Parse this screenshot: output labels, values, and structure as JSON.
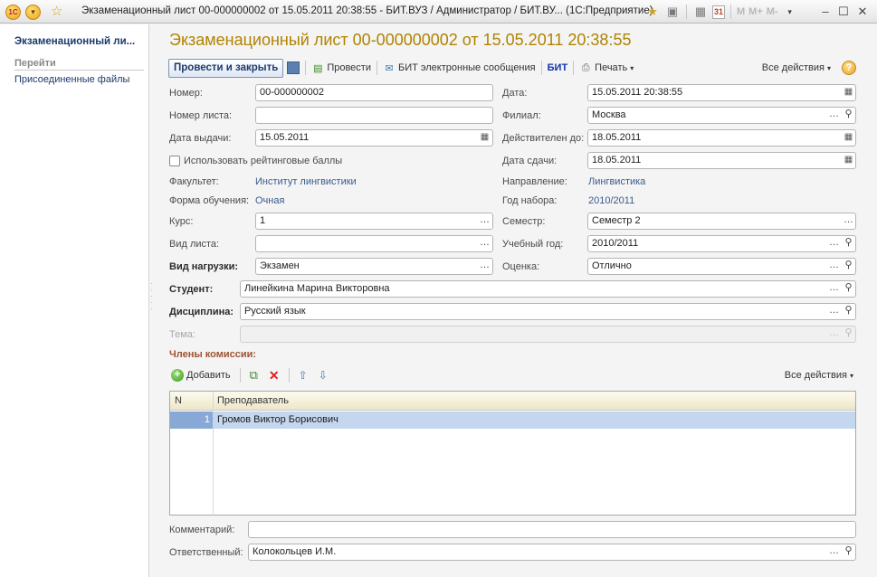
{
  "window": {
    "title": "Экзаменационный лист 00-000000002 от 15.05.2011 20:38:55 - БИТ.ВУЗ / Администратор / БИТ.ВУ...   (1С:Предприятие)",
    "logo": "1С",
    "memory_buttons": [
      "M",
      "M+",
      "M-"
    ],
    "calendar_day": "31"
  },
  "left_panel": {
    "title": "Экзаменационный ли...",
    "section": "Перейти",
    "links": [
      "Присоединенные файлы"
    ]
  },
  "form": {
    "title": "Экзаменационный лист 00-000000002 от 15.05.2011 20:38:55",
    "toolbar": {
      "post_and_close": "Провести и закрыть",
      "post": "Провести",
      "bit_messages": "БИТ электронные сообщения",
      "bit_logo": "БИТ",
      "print": "Печать",
      "all_actions": "Все действия",
      "help": "?"
    },
    "fields": {
      "number_label": "Номер:",
      "number": "00-000000002",
      "date_label": "Дата:",
      "date": "15.05.2011 20:38:55",
      "sheet_number_label": "Номер листа:",
      "sheet_number": "",
      "branch_label": "Филиал:",
      "branch": "Москва",
      "issue_date_label": "Дата выдачи:",
      "issue_date": "15.05.2011",
      "valid_until_label": "Действителен до:",
      "valid_until": "18.05.2011",
      "use_rating_label": "Использовать рейтинговые баллы",
      "use_rating": false,
      "submit_date_label": "Дата сдачи:",
      "submit_date": "18.05.2011",
      "faculty_label": "Факультет:",
      "faculty": "Институт лингвистики",
      "direction_label": "Направление:",
      "direction": "Лингвистика",
      "study_form_label": "Форма обучения:",
      "study_form": "Очная",
      "enroll_year_label": "Год набора:",
      "enroll_year": "2010/2011",
      "course_label": "Курс:",
      "course": "1",
      "semester_label": "Семестр:",
      "semester": "Семестр 2",
      "sheet_type_label": "Вид листа:",
      "sheet_type": "",
      "academic_year_label": "Учебный год:",
      "academic_year": "2010/2011",
      "load_type_label": "Вид нагрузки:",
      "load_type": "Экзамен",
      "grade_label": "Оценка:",
      "grade": "Отлично",
      "student_label": "Студент:",
      "student": "Линейкина Марина Викторовна",
      "discipline_label": "Дисциплина:",
      "discipline": "Русский язык",
      "topic_label": "Тема:",
      "topic": "",
      "comment_label": "Комментарий:",
      "comment": "",
      "responsible_label": "Ответственный:",
      "responsible": "Колокольцев И.М."
    },
    "commission": {
      "title": "Члены комиссии:",
      "add": "Добавить",
      "all_actions": "Все действия",
      "columns": [
        "N",
        "Преподаватель"
      ],
      "rows": [
        {
          "n": "1",
          "teacher": "Громов Виктор Борисович"
        }
      ]
    }
  },
  "colors": {
    "title_gold": "#b08300",
    "link_blue": "#3a5a8c",
    "section_brown": "#a0522d",
    "row_selected": "#c5d7ee"
  }
}
